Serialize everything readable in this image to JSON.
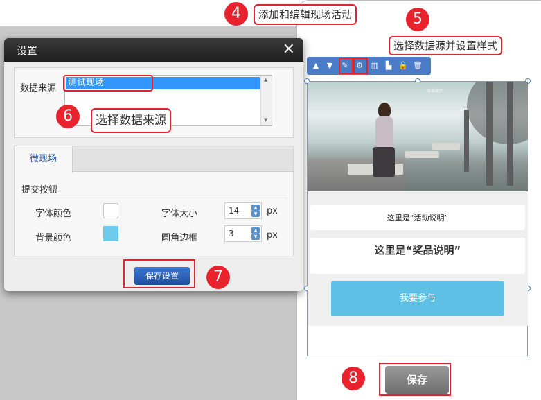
{
  "dialog": {
    "title": "设置",
    "close_glyph": "✕",
    "data_source": {
      "label": "数据来源",
      "selected_item": "测试现场"
    },
    "tab": "微现场",
    "section_title": "提交按钮",
    "font_color_label": "字体颜色",
    "font_color": "#ffffff",
    "bg_color_label": "背景颜色",
    "bg_color": "#6ccbed",
    "font_size_label": "字体大小",
    "font_size_value": "14",
    "radius_label": "圆角边框",
    "radius_value": "3",
    "unit": "px",
    "save_settings_label": "保存设置"
  },
  "callouts": {
    "n4": "4",
    "t4": "添加和编辑现场活动",
    "n5": "5",
    "t5": "选择数据源并设置样式",
    "n6": "6",
    "t6": "选择数据来源",
    "n7": "7",
    "n8": "8"
  },
  "toolbar": {
    "icons": [
      "up-icon",
      "down-icon",
      "edit-icon",
      "gear-icon",
      "columns-icon",
      "chart-icon",
      "unlock-icon",
      "trash-icon"
    ]
  },
  "phone": {
    "watermark": "唯美图片",
    "activity_text": "这里是“活动说明”",
    "prize_text": "这里是“奖品说明”",
    "join_button": "我要参与",
    "save_button": "保存"
  },
  "colors": {
    "accent_red": "#e8232d",
    "toolbar_blue": "#4a7bc7",
    "join_blue": "#5ec0e5"
  }
}
